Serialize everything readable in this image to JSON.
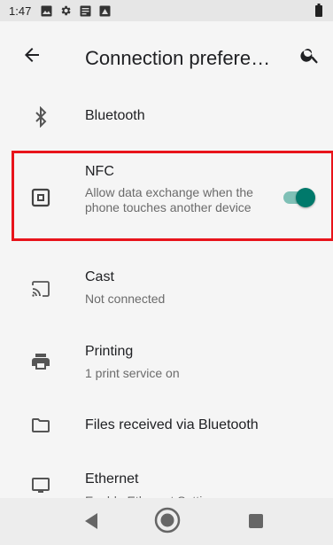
{
  "status_bar": {
    "time": "1:47",
    "icons": [
      "photo-icon",
      "gear-icon",
      "notes-icon",
      "photo-icon"
    ]
  },
  "toolbar": {
    "title": "Connection prefere…",
    "back_icon": "arrow-back-icon",
    "search_icon": "search-icon"
  },
  "items": [
    {
      "title": "Bluetooth",
      "icon": "bluetooth-icon"
    },
    {
      "title": "NFC",
      "subtitle": "Allow data exchange when the phone touches another device",
      "icon": "nfc-icon",
      "toggle_on": true
    },
    {
      "title": "Cast",
      "subtitle": "Not connected",
      "icon": "cast-icon"
    },
    {
      "title": "Printing",
      "subtitle": "1 print service on",
      "icon": "print-icon"
    },
    {
      "title": "Files received via Bluetooth",
      "icon": "folder-icon"
    },
    {
      "title": "Ethernet",
      "subtitle": "Enable Ethernet Settings",
      "icon": "monitor-icon"
    }
  ],
  "colors": {
    "accent": "#00796b",
    "highlight": "#e8141b"
  },
  "navbar": {
    "back_icon": "nav-back-icon",
    "home_icon": "nav-home-icon",
    "recents_icon": "nav-recents-icon"
  }
}
